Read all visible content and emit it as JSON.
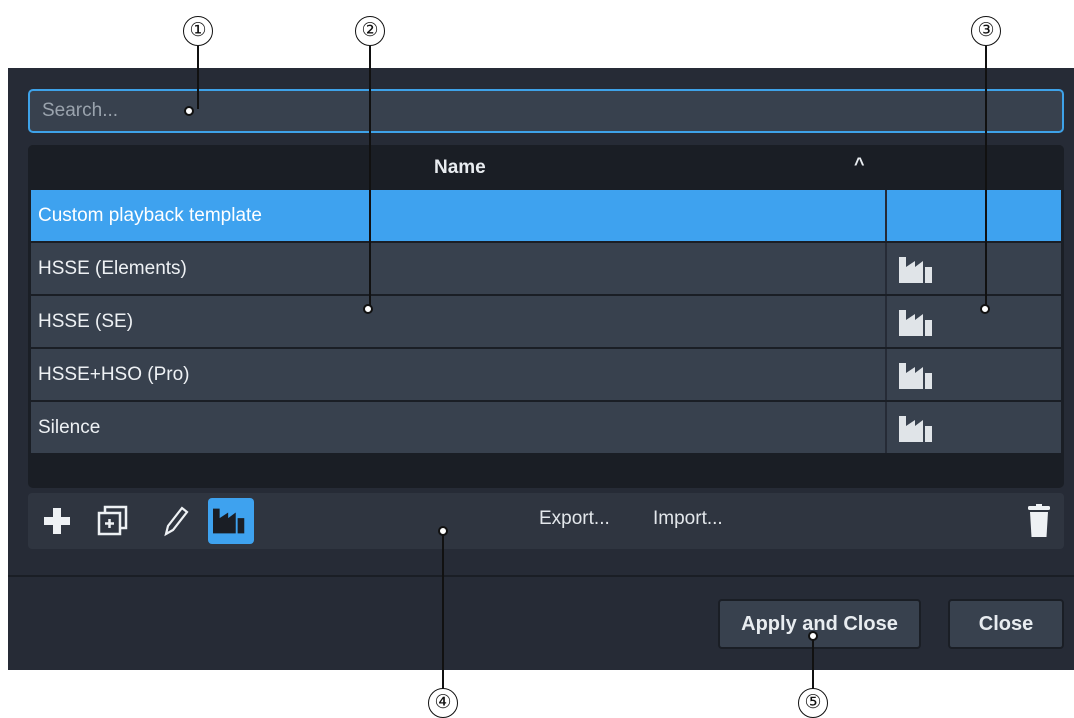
{
  "callouts": [
    "①",
    "②",
    "③",
    "④",
    "⑤"
  ],
  "search": {
    "placeholder": "Search..."
  },
  "table": {
    "column_header": "Name",
    "sort_indicator": "^",
    "rows": [
      {
        "name": "Custom playback template",
        "factory": false,
        "selected": true
      },
      {
        "name": "HSSE (Elements)",
        "factory": true
      },
      {
        "name": "HSSE (SE)",
        "factory": true
      },
      {
        "name": "HSSE+HSO (Pro)",
        "factory": true
      },
      {
        "name": "Silence",
        "factory": true
      }
    ]
  },
  "toolbar": {
    "icons": [
      "plus-icon",
      "duplicate-icon",
      "edit-pencil-icon",
      "factory-icon",
      "trash-icon"
    ],
    "export_label": "Export...",
    "import_label": "Import..."
  },
  "footer": {
    "apply_label": "Apply and Close",
    "close_label": "Close"
  },
  "colors": {
    "dialog_bg": "#262b36",
    "row_bg": "#38414e",
    "accent": "#3ea2ef"
  }
}
